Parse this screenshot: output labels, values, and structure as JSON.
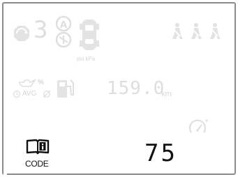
{
  "display": {
    "gear_indicator": "3",
    "tire_pressure_unit": "psi kPa",
    "avg_label": "AVG",
    "fuel_unit": "%",
    "range_value": "159.0",
    "range_unit": "km",
    "info_label": "CODE",
    "speed_value": "75"
  },
  "icons": {
    "stop_start": "stop-start-icon",
    "auto_mode": "auto-mode-icon",
    "tire_pressure": "car-top-tire-pressure-icon",
    "seatbelt": "seatbelt-reminder-icon",
    "oil_consumption": "oil-can-icon",
    "fuel_pump": "fuel-pump-icon",
    "info_book": "info-book-icon",
    "cruise": "speed-limiter-gauge-icon"
  },
  "colors": {
    "active": "#111111",
    "inactive": "#dfdfdf",
    "frame": "#8a8a8a"
  }
}
